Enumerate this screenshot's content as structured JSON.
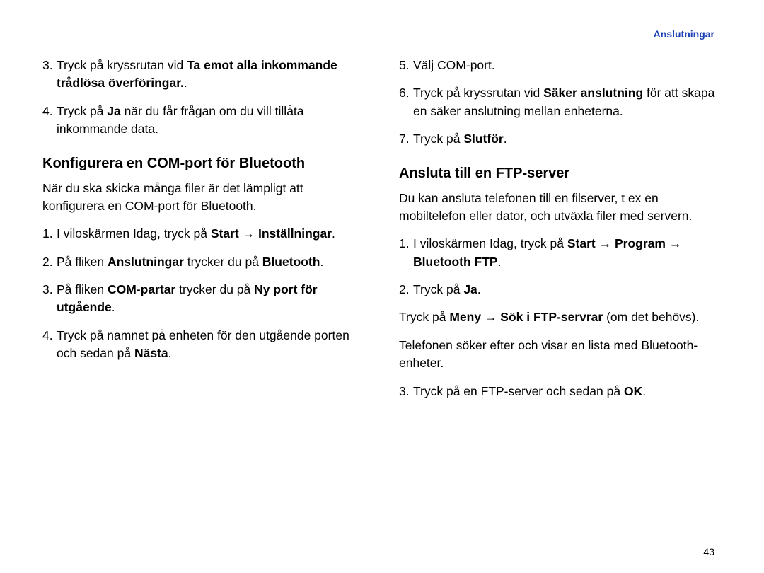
{
  "header": {
    "section": "Anslutningar"
  },
  "page_number": "43",
  "left": {
    "item3_num": "3.",
    "item3_a": "Tryck på kryssrutan vid ",
    "item3_b": "Ta emot alla inkommande trådlösa överföringar.",
    "item3_c": ".",
    "item4_num": "4.",
    "item4_a": "Tryck på ",
    "item4_b": "Ja",
    "item4_c": " när du får frågan om du vill tillåta inkommande data.",
    "h1": "Konfigurera en COM-port för Bluetooth",
    "intro": "När du ska skicka många filer är det lämpligt att konfigurera en COM-port för Bluetooth.",
    "s1_num": "1.",
    "s1_a": "I viloskärmen Idag, tryck på ",
    "s1_b": "Start",
    "s1_c": " → ",
    "s1_d": "Inställningar",
    "s1_e": ".",
    "s2_num": "2.",
    "s2_a": "På fliken ",
    "s2_b": "Anslutningar",
    "s2_c": " trycker du på ",
    "s2_d": "Bluetooth",
    "s2_e": ".",
    "s3_num": "3.",
    "s3_a": "På fliken ",
    "s3_b": "COM-partar",
    "s3_c": " trycker du på ",
    "s3_d": "Ny port för utgående",
    "s3_e": ".",
    "s4_num": "4.",
    "s4_a": "Tryck på namnet på enheten för den utgående porten och sedan på ",
    "s4_b": "Nästa",
    "s4_c": "."
  },
  "right": {
    "r5_num": "5.",
    "r5_a": "Välj COM-port.",
    "r6_num": "6.",
    "r6_a": "Tryck på kryssrutan vid ",
    "r6_b": "Säker anslutning",
    "r6_c": " för att skapa en säker anslutning mellan enheterna.",
    "r7_num": "7.",
    "r7_a": "Tryck på ",
    "r7_b": "Slutför",
    "r7_c": ".",
    "h2": "Ansluta till en FTP-server",
    "intro2": "Du kan ansluta telefonen till en filserver, t ex en mobiltelefon eller dator, och utväxla filer med servern.",
    "f1_num": "1.",
    "f1_a": "I viloskärmen Idag, tryck på ",
    "f1_b": "Start",
    "f1_c": " → ",
    "f1_d": "Program",
    "f1_e": " → ",
    "f1_f": "Bluetooth FTP",
    "f1_g": ".",
    "f2_num": "2.",
    "f2_a": "Tryck på ",
    "f2_b": "Ja",
    "f2_c": ".",
    "f2s_a": "Tryck på ",
    "f2s_b": "Meny",
    "f2s_c": " → ",
    "f2s_d": "Sök i FTP-servrar",
    "f2s_e": " (om det behövs).",
    "f2t": "Telefonen söker efter och visar en lista med Bluetooth-enheter.",
    "f3_num": "3.",
    "f3_a": "Tryck på en FTP-server och sedan på ",
    "f3_b": "OK",
    "f3_c": "."
  }
}
